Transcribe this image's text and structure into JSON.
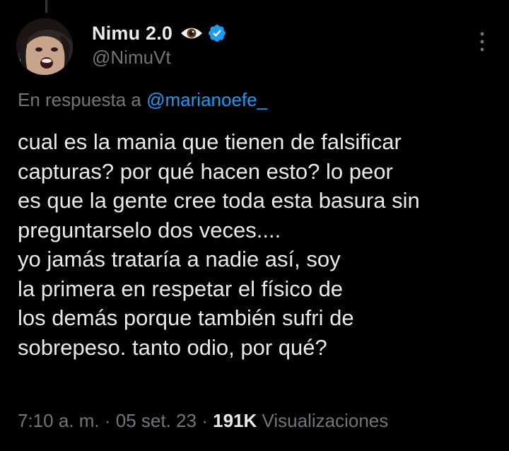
{
  "author": {
    "display_name": "Nimu 2.0",
    "handle": "@NimuVt",
    "verified": true,
    "name_emoji": "eye-icon",
    "avatar": "avatar-photo"
  },
  "reply": {
    "prefix": "En respuesta a",
    "mention": "@marianoefe_"
  },
  "tweet": {
    "lines": [
      "cual es la mania que tienen de falsificar",
      "capturas? por qué hacen esto? lo peor",
      "es que la gente cree toda esta basura sin",
      "preguntarselo dos veces....",
      "yo jamás trataría a nadie así, soy",
      "la primera en respetar el físico de",
      "los demás porque también sufri de",
      "sobrepeso. tanto odio, por qué?"
    ]
  },
  "meta": {
    "time": "7:10 a. m.",
    "separator": "·",
    "date": "05 set. 23",
    "views_count": "191K",
    "views_label": "Visualizaciones"
  },
  "colors": {
    "background": "#000000",
    "text_primary": "#e7e9ea",
    "text_secondary": "#71767b",
    "accent": "#1d9bf0"
  }
}
